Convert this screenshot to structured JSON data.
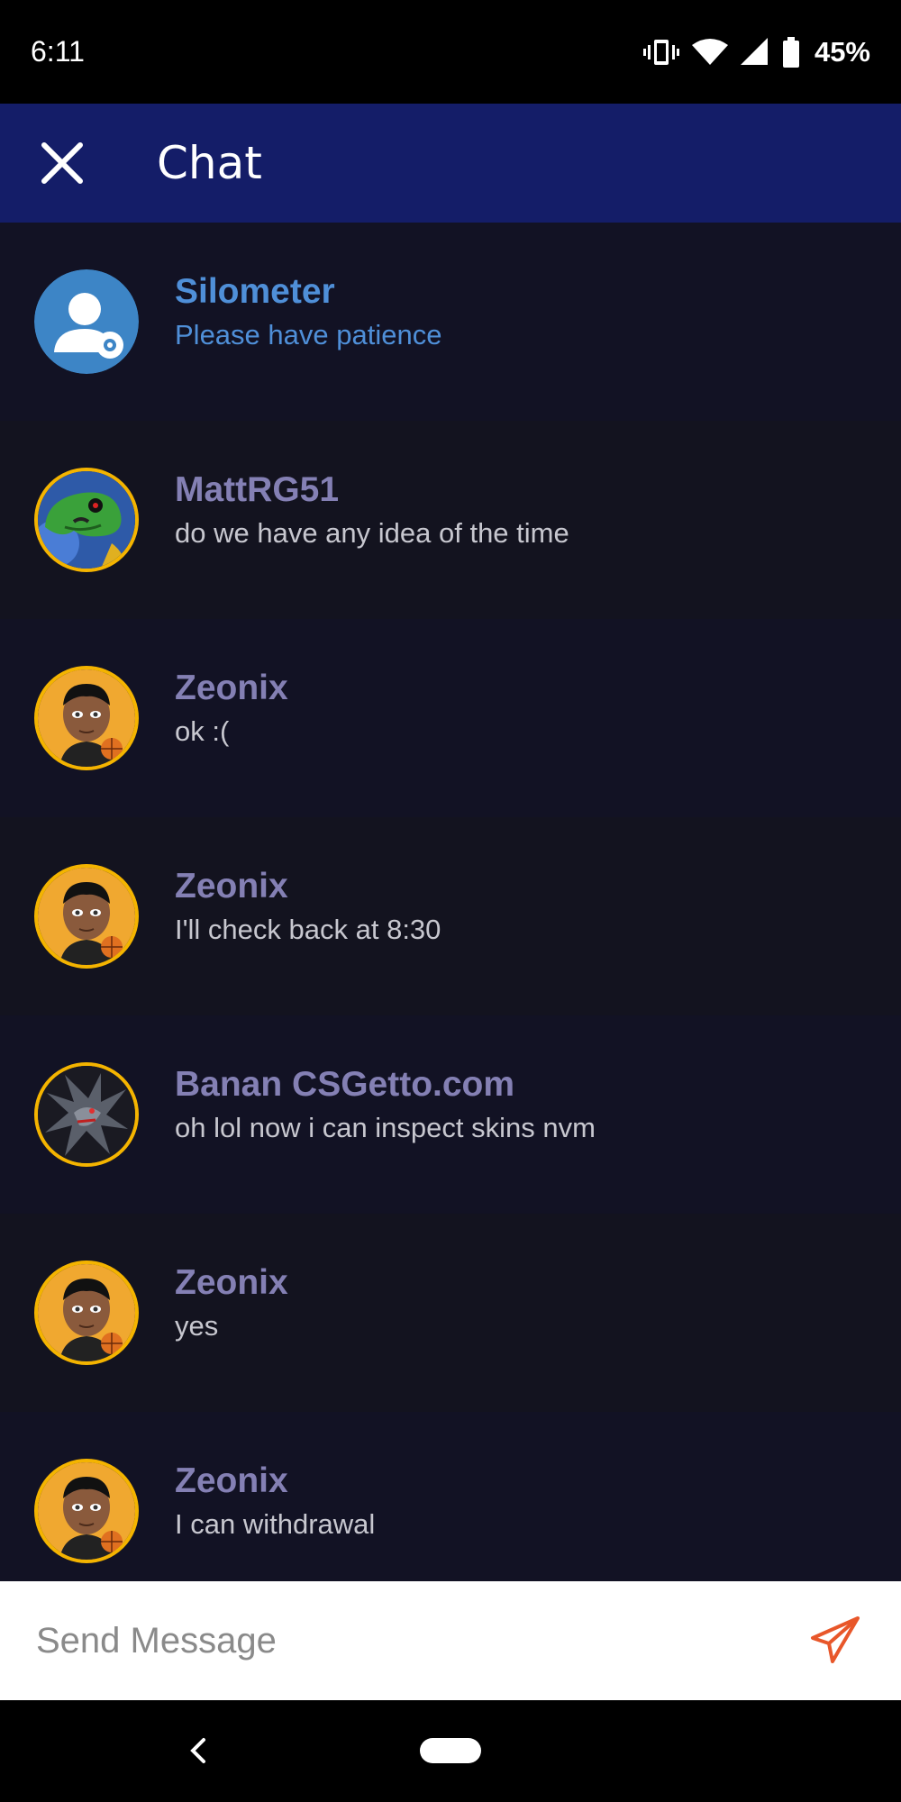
{
  "status_bar": {
    "time": "6:11",
    "battery": "45%",
    "icons": [
      "vibrate-icon",
      "wifi-icon",
      "cell-signal-icon",
      "battery-icon"
    ]
  },
  "app_bar": {
    "title": "Chat",
    "close_icon": "close-icon"
  },
  "messages": [
    {
      "name": "Silometer",
      "text": "Please have patience",
      "avatar": "admin-avatar"
    },
    {
      "name": "MattRG51",
      "text": "do we have any idea of the time",
      "avatar": "dinosaur-avatar"
    },
    {
      "name": "Zeonix",
      "text": "ok :(",
      "avatar": "cartoon-boy-avatar"
    },
    {
      "name": "Zeonix",
      "text": "I'll check back at 8:30",
      "avatar": "cartoon-boy-avatar"
    },
    {
      "name": "Banan CSGetto.com",
      "text": "oh lol now i can inspect skins nvm",
      "avatar": "dragon-avatar"
    },
    {
      "name": "Zeonix",
      "text": "yes",
      "avatar": "cartoon-boy-avatar"
    },
    {
      "name": "Zeonix",
      "text": "I can withdrawal",
      "avatar": "cartoon-boy-avatar"
    }
  ],
  "compose": {
    "placeholder": "Send Message",
    "value": "",
    "send_icon": "send-icon"
  },
  "colors": {
    "app_bar": "#141d68",
    "background": "#111120",
    "admin_accent": "#4f8fd8",
    "user_name": "#8480b4",
    "send_accent": "#e8572a",
    "avatar_ring": "#f4b400"
  }
}
